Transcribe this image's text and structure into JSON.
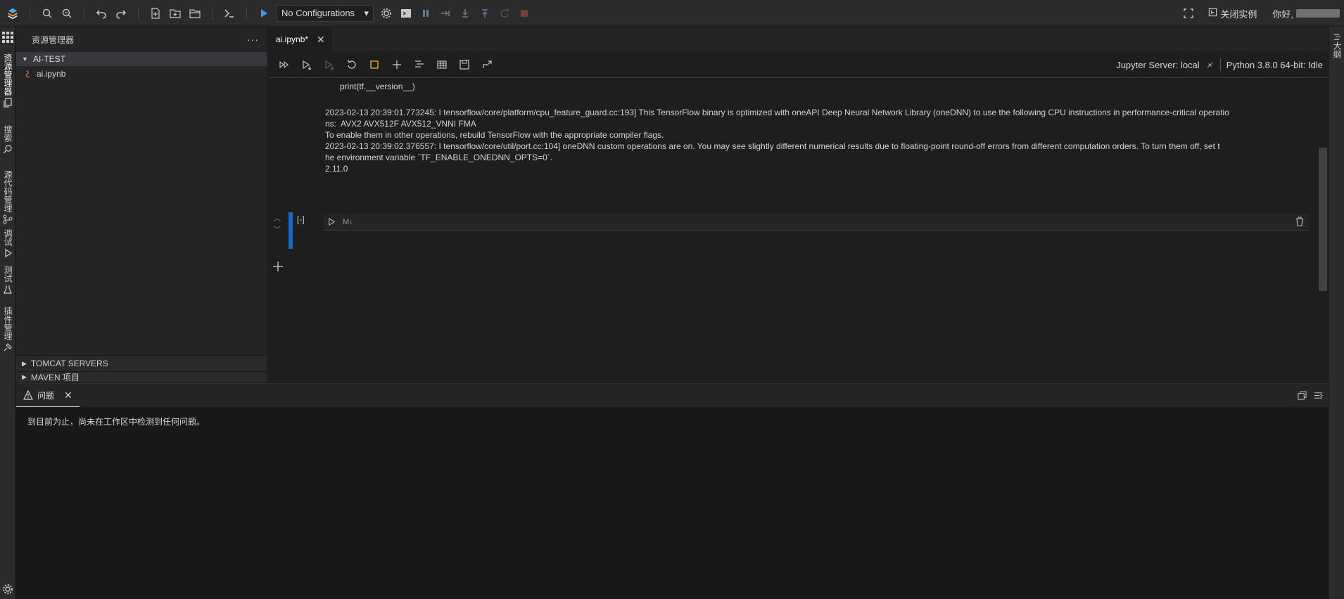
{
  "toolbar": {
    "config_select": "No Configurations",
    "close_instance": "关闭实例",
    "greeting": "你好,"
  },
  "activity_bar": {
    "items": [
      "资源管理器",
      "搜索",
      "源代码管理",
      "调试",
      "测试",
      "插件管理"
    ]
  },
  "right_bar": {
    "outline": "大纲"
  },
  "explorer": {
    "title": "资源管理器",
    "more": "···",
    "root": "AI-TEST",
    "file": "ai.ipynb",
    "tomcat": "TOMCAT SERVERS",
    "maven": "MAVEN 项目"
  },
  "editor": {
    "tab_label": "ai.ipynb*",
    "jupyter_server": "Jupyter Server: local",
    "kernel": "Python 3.8.0 64-bit: Idle",
    "code_line": "print(tf.__version__)",
    "output_lines": [
      "2023-02-13 20:39:01.773245: I tensorflow/core/platform/cpu_feature_guard.cc:193] This TensorFlow binary is optimized with oneAPI Deep Neural Network Library (oneDNN) to use the following CPU instructions in performance-critical operatio",
      "ns:  AVX2 AVX512F AVX512_VNNI FMA",
      "To enable them in other operations, rebuild TensorFlow with the appropriate compiler flags.",
      "2023-02-13 20:39:02.376557: I tensorflow/core/util/port.cc:104] oneDNN custom operations are on. You may see slightly different numerical results due to floating-point round-off errors from different computation orders. To turn them off, set t",
      "he environment variable `TF_ENABLE_ONEDNN_OPTS=0`.",
      "2.11.0"
    ],
    "cell_exec_count": "[-]",
    "cell_language": "M↓"
  },
  "panel": {
    "tab_label": "问题",
    "message": "到目前为止，尚未在工作区中检测到任何问题。"
  }
}
